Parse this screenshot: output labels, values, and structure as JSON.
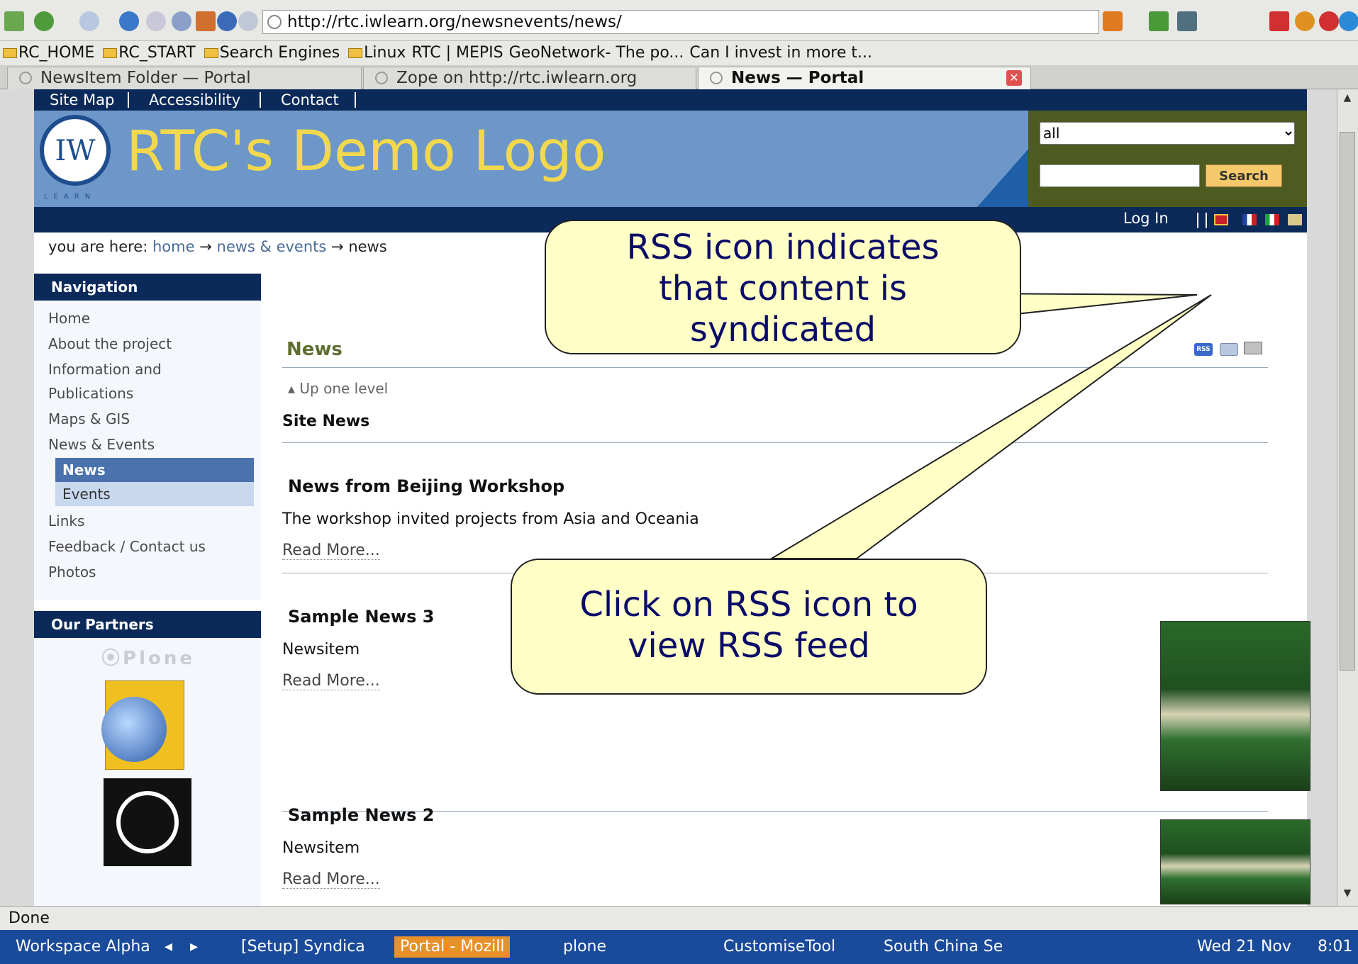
{
  "browser": {
    "url": "http://rtc.iwlearn.org/newsnevents/news/",
    "bookmarks": [
      "RC_HOME",
      "RC_START",
      "Search Engines",
      "Linux",
      "RTC | MEPIS",
      "GeoNetwork- The po...",
      "Can I invest in more t..."
    ],
    "tabs": [
      {
        "label": "NewsItem Folder — Portal"
      },
      {
        "label": "Zope on http://rtc.iwlearn.org"
      },
      {
        "label": "News — Portal"
      }
    ],
    "status": "Done"
  },
  "site": {
    "top_links": [
      "Site Map",
      "Accessibility",
      "Contact"
    ],
    "logo_letters": "IW",
    "logo_sub": "LEARN",
    "logo_text": "RTC's Demo Logo",
    "search_scope": "all",
    "search_button": "Search",
    "login": "Log In",
    "breadcrumb": {
      "prefix": "you are here:",
      "home": "home",
      "arrow": "→",
      "events": "news & events",
      "current": "news"
    }
  },
  "nav": {
    "title": "Navigation",
    "items": [
      "Home",
      "About the project",
      "Information and",
      "Publications",
      "Maps & GIS",
      "News & Events"
    ],
    "sub_items": [
      "News",
      "Events"
    ],
    "more_items": [
      "Links",
      "Feedback / Contact us",
      "Photos"
    ]
  },
  "partners": {
    "title": "Our Partners",
    "plone": "Plone"
  },
  "content": {
    "title": "News",
    "up_one_level": "Up one level",
    "section": "Site News",
    "rss_label": "RSS",
    "items": [
      {
        "title": "News from Beijing Workshop",
        "description": "The workshop invited projects from Asia and Oceania",
        "read_more": "Read More..."
      },
      {
        "title": "Sample News 3",
        "description": "Newsitem",
        "read_more": "Read More..."
      },
      {
        "title": "Sample News 2",
        "description": "Newsitem",
        "read_more": "Read More..."
      }
    ]
  },
  "callouts": {
    "top_line1": "RSS icon indicates",
    "top_line2": "that content is",
    "top_line3": "syndicated",
    "bottom_line1": "Click on RSS icon to",
    "bottom_line2": "view RSS feed"
  },
  "taskbar": {
    "workspace": "Workspace Alpha",
    "tasks": [
      "[Setup] Syndica",
      "Portal - Mozill",
      "plone",
      "CustomiseTool",
      "South China Se"
    ],
    "date": "Wed 21 Nov",
    "time": "8:01"
  },
  "colors": {
    "nav_blue": "#0b2a5a",
    "banner_blue": "#6d97c8",
    "search_olive": "#4d5a20",
    "callout_fill": "#ffffc6",
    "callout_text": "#0a0a68"
  }
}
